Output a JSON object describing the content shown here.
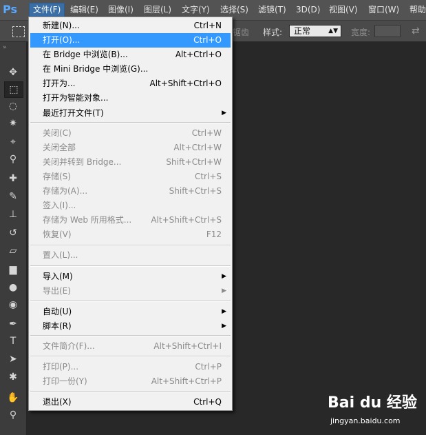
{
  "app": {
    "logo": "Ps"
  },
  "menubar": [
    {
      "label": "文件(F)",
      "active": true
    },
    {
      "label": "编辑(E)"
    },
    {
      "label": "图像(I)"
    },
    {
      "label": "图层(L)"
    },
    {
      "label": "文字(Y)"
    },
    {
      "label": "选择(S)"
    },
    {
      "label": "滤镜(T)"
    },
    {
      "label": "3D(D)"
    },
    {
      "label": "视图(V)"
    },
    {
      "label": "窗口(W)"
    },
    {
      "label": "帮助"
    }
  ],
  "options_bar": {
    "faded_text": "锯齿",
    "style_label": "样式:",
    "style_value": "正常",
    "width_label": "宽度:",
    "tool_icon": "rect-marquee-icon",
    "swap_icon": "swap-arrows-icon"
  },
  "toolbar": {
    "grip": "»",
    "tools": [
      {
        "name": "move-tool-icon",
        "glyph": "✥"
      },
      {
        "name": "rect-marquee-tool-icon",
        "glyph": "⬚",
        "selected": true
      },
      {
        "name": "lasso-tool-icon",
        "glyph": "◌"
      },
      {
        "name": "magic-wand-tool-icon",
        "glyph": "✷"
      },
      {
        "name": "crop-tool-icon",
        "glyph": "⌖"
      },
      {
        "name": "eyedropper-tool-icon",
        "glyph": "⚲"
      },
      {
        "name": "healing-brush-tool-icon",
        "glyph": "✚"
      },
      {
        "name": "brush-tool-icon",
        "glyph": "✎"
      },
      {
        "name": "clone-stamp-tool-icon",
        "glyph": "⊥"
      },
      {
        "name": "history-brush-tool-icon",
        "glyph": "↺"
      },
      {
        "name": "eraser-tool-icon",
        "glyph": "▱"
      },
      {
        "name": "gradient-tool-icon",
        "glyph": "▆"
      },
      {
        "name": "blur-tool-icon",
        "glyph": "●"
      },
      {
        "name": "dodge-tool-icon",
        "glyph": "◉"
      },
      {
        "name": "pen-tool-icon",
        "glyph": "✒"
      },
      {
        "name": "type-tool-icon",
        "glyph": "T"
      },
      {
        "name": "path-selection-tool-icon",
        "glyph": "➤"
      },
      {
        "name": "shape-tool-icon",
        "glyph": "✱"
      },
      {
        "name": "hand-tool-icon",
        "glyph": "✋"
      },
      {
        "name": "zoom-tool-icon",
        "glyph": "⚲"
      }
    ]
  },
  "file_menu": {
    "items": [
      {
        "label": "新建(N)...",
        "shortcut": "Ctrl+N"
      },
      {
        "label": "打开(O)...",
        "shortcut": "Ctrl+O",
        "highlight": true
      },
      {
        "label": "在 Bridge 中浏览(B)...",
        "shortcut": "Alt+Ctrl+O"
      },
      {
        "label": "在 Mini Bridge 中浏览(G)...",
        "shortcut": ""
      },
      {
        "label": "打开为...",
        "shortcut": "Alt+Shift+Ctrl+O"
      },
      {
        "label": "打开为智能对象...",
        "shortcut": ""
      },
      {
        "label": "最近打开文件(T)",
        "shortcut": "",
        "submenu": true
      },
      {
        "label": "关闭(C)",
        "shortcut": "Ctrl+W",
        "disabled": true
      },
      {
        "label": "关闭全部",
        "shortcut": "Alt+Ctrl+W",
        "disabled": true
      },
      {
        "label": "关闭并转到 Bridge...",
        "shortcut": "Shift+Ctrl+W",
        "disabled": true
      },
      {
        "label": "存储(S)",
        "shortcut": "Ctrl+S",
        "disabled": true
      },
      {
        "label": "存储为(A)...",
        "shortcut": "Shift+Ctrl+S",
        "disabled": true
      },
      {
        "label": "签入(I)...",
        "shortcut": "",
        "disabled": true
      },
      {
        "label": "存储为 Web 所用格式...",
        "shortcut": "Alt+Shift+Ctrl+S",
        "disabled": true
      },
      {
        "label": "恢复(V)",
        "shortcut": "F12",
        "disabled": true
      },
      {
        "label": "置入(L)...",
        "shortcut": "",
        "disabled": true
      },
      {
        "label": "导入(M)",
        "shortcut": "",
        "submenu": true
      },
      {
        "label": "导出(E)",
        "shortcut": "",
        "submenu": true,
        "disabled": true
      },
      {
        "label": "自动(U)",
        "shortcut": "",
        "submenu": true
      },
      {
        "label": "脚本(R)",
        "shortcut": "",
        "submenu": true
      },
      {
        "label": "文件简介(F)...",
        "shortcut": "Alt+Shift+Ctrl+I",
        "disabled": true
      },
      {
        "label": "打印(P)...",
        "shortcut": "Ctrl+P",
        "disabled": true
      },
      {
        "label": "打印一份(Y)",
        "shortcut": "Alt+Shift+Ctrl+P",
        "disabled": true
      },
      {
        "label": "退出(X)",
        "shortcut": "Ctrl+Q"
      }
    ],
    "submenu_arrow": "▶"
  },
  "watermark": {
    "brand": "Bai du 经验",
    "url": "jingyan.baidu.com"
  },
  "colors": {
    "accent": "#3399ff",
    "menubar_active": "#3a6ea5",
    "menu_bg": "#f1f1f1",
    "workspace": "#282828"
  }
}
